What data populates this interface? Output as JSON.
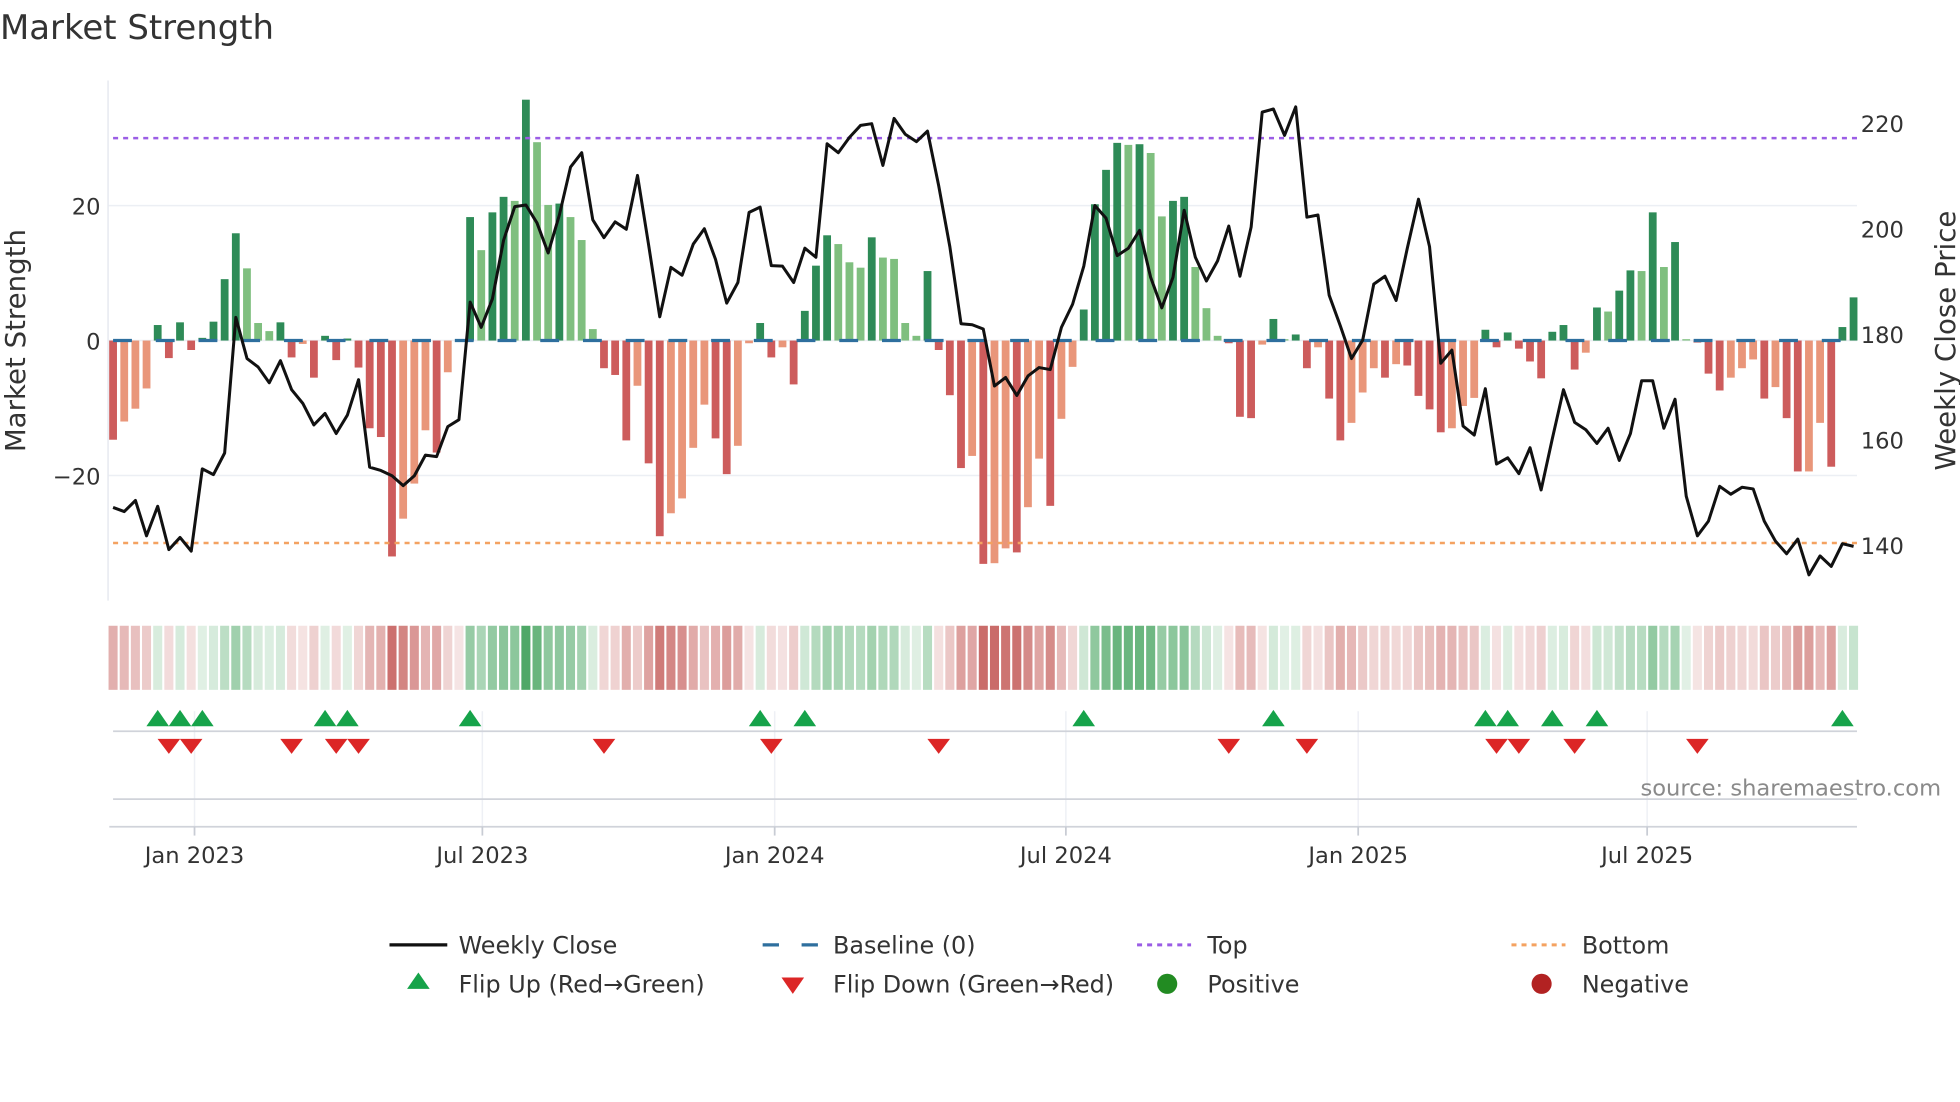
{
  "title": "Market Strength",
  "source": "source: sharemaestro.com",
  "colors": {
    "pos_dark": "#2e8b57",
    "pos_light": "#7fbf7f",
    "neg_dark": "#cd5c5c",
    "neg_light": "#e9967a",
    "heat_pos": "#3a9e55",
    "heat_neg": "#c0504d",
    "close": "#111111",
    "baseline": "#2e6f9e",
    "top": "#9b5de5",
    "bottom": "#f4a261",
    "flip_up": "#16a34a",
    "flip_down": "#dc2626",
    "positive": "#228b22",
    "negative": "#b22222"
  },
  "chart_data": {
    "type": "bar",
    "title": "Market Strength",
    "frequency": "weekly",
    "ylabel": "Market Strength",
    "y2label": "Weekly Close Price",
    "ylim": [
      -36,
      41
    ],
    "y2lim": [
      129,
      223
    ],
    "yticks": [
      {
        "value": 20,
        "label": "20"
      },
      {
        "value": 0,
        "label": "0"
      },
      {
        "value": -20,
        "label": "−20"
      }
    ],
    "y2ticks": [
      {
        "value": 220,
        "label": "220"
      },
      {
        "value": 200,
        "label": "200"
      },
      {
        "value": 180,
        "label": "180"
      },
      {
        "value": 160,
        "label": "160"
      },
      {
        "value": 140,
        "label": "140"
      }
    ],
    "xticks": [
      {
        "week_index": 7.3,
        "label": "Jan 2023"
      },
      {
        "week_index": 33.1,
        "label": "Jul 2023"
      },
      {
        "week_index": 59.3,
        "label": "Jan 2024"
      },
      {
        "week_index": 85.4,
        "label": "Jul 2024"
      },
      {
        "week_index": 111.6,
        "label": "Jan 2025"
      },
      {
        "week_index": 137.5,
        "label": "Jul 2025"
      }
    ],
    "baseline": 0,
    "top": 30,
    "bottom": -30,
    "strength": [
      -14.7,
      -12,
      -10.1,
      -7.1,
      2.3,
      -2.6,
      2.7,
      -1.4,
      0.4,
      2.8,
      9.1,
      15.9,
      10.7,
      2.6,
      1.4,
      2.7,
      -2.5,
      -0.5,
      -5.5,
      0.7,
      -2.9,
      0.3,
      -4,
      -13,
      -14.3,
      -32,
      -26.4,
      -21.2,
      -13.3,
      -16.6,
      -4.7,
      -0.2,
      18.3,
      13.4,
      19,
      21.3,
      20.7,
      35.7,
      29.4,
      20.1,
      20.3,
      18.3,
      14.9,
      1.7,
      -4.1,
      -5.1,
      -14.8,
      -6.7,
      -18.2,
      -29,
      -25.6,
      -23.4,
      -15.9,
      -9.5,
      -14.5,
      -19.8,
      -15.6,
      -0.4,
      2.6,
      -2.5,
      -1,
      -6.5,
      4.4,
      11.1,
      15.6,
      14.3,
      11.6,
      10.8,
      15.3,
      12.3,
      12.1,
      2.6,
      0.7,
      10.3,
      -1.4,
      -8.1,
      -18.9,
      -17.1,
      -33.1,
      -33,
      -30.8,
      -31.4,
      -24.7,
      -17.5,
      -24.5,
      -11.6,
      -3.9,
      4.6,
      20.2,
      25.3,
      29.3,
      29,
      29.1,
      27.8,
      18.4,
      20.7,
      21.3,
      10.9,
      4.8,
      0.7,
      -0.4,
      -11.3,
      -11.5,
      -0.6,
      3.2,
      0.2,
      0.9,
      -4.1,
      -1,
      -8.6,
      -14.8,
      -12.2,
      -7.7,
      -4.1,
      -5.5,
      -3.5,
      -3.7,
      -8.2,
      -10.2,
      -13.6,
      -13,
      -9.7,
      -8.5,
      1.6,
      -1,
      1.2,
      -1.2,
      -3.1,
      -5.6,
      1.3,
      2.3,
      -4.3,
      -1.8,
      4.9,
      4.3,
      7.4,
      10.4,
      10.3,
      19,
      10.9,
      14.6,
      0.2,
      -0.3,
      -4.9,
      -7.4,
      -5.5,
      -4.1,
      -2.8,
      -8.6,
      -6.9,
      -11.5,
      -19.4,
      -19.4,
      -12.2,
      -18.7,
      2,
      6.4
    ],
    "close": [
      147.2,
      146.4,
      148.5,
      141.8,
      147.4,
      139.2,
      141.5,
      138.9,
      154.5,
      153.4,
      157.5,
      183.2,
      175.4,
      173.8,
      170.8,
      175,
      169.5,
      166.9,
      162.8,
      165,
      161.2,
      164.7,
      171.4,
      154.8,
      154.2,
      153.2,
      151.3,
      153.2,
      157.1,
      156.8,
      162.5,
      163.8,
      186.1,
      181.3,
      186.7,
      197.8,
      204.2,
      204.5,
      201.1,
      195.4,
      202.6,
      211.7,
      214.4,
      201.7,
      198.3,
      201.3,
      199.9,
      210.1,
      197,
      183.3,
      192.7,
      191.2,
      197.1,
      200,
      194.2,
      185.9,
      189.8,
      203.1,
      204.1,
      193,
      192.9,
      189.8,
      196.3,
      194.6,
      216.1,
      214.4,
      217.3,
      219.6,
      219.9,
      212,
      220.9,
      217.9,
      216.5,
      218.5,
      208.2,
      196.6,
      182,
      181.8,
      181,
      170.2,
      171.8,
      168.4,
      172.1,
      173.7,
      173.3,
      181.3,
      185.7,
      192.9,
      204.4,
      202,
      194.9,
      196.3,
      199.7,
      190.8,
      185,
      190.8,
      203.5,
      194.6,
      190.1,
      193.9,
      200.5,
      191,
      200.3,
      222.1,
      222.7,
      217.7,
      223.1,
      202.2,
      202.6,
      187.4,
      181.6,
      175.4,
      178.9,
      189.5,
      191,
      186.4,
      196.3,
      205.6,
      196.6,
      174.5,
      177,
      162.6,
      160.9,
      169.7,
      155.4,
      156.6,
      153.6,
      158.5,
      150.5,
      160.2,
      169.5,
      163.3,
      161.9,
      159.3,
      162.2,
      156.1,
      161.2,
      171.2,
      171.2,
      162.2,
      167.7,
      149.3,
      141.8,
      144.6,
      151.2,
      149.7,
      151,
      150.7,
      144.6,
      140.8,
      138.4,
      141.2,
      134.4,
      138,
      136,
      140.3,
      139.8
    ],
    "legend": {
      "placement": "bottom",
      "items": [
        {
          "key": "close",
          "label": "Weekly Close"
        },
        {
          "key": "baseline",
          "label": "Baseline (0)"
        },
        {
          "key": "top",
          "label": "Top"
        },
        {
          "key": "bottom",
          "label": "Bottom"
        },
        {
          "key": "flip_up",
          "label": "Flip Up (Red→Green)"
        },
        {
          "key": "flip_down",
          "label": "Flip Down (Green→Red)"
        },
        {
          "key": "positive",
          "label": "Positive"
        },
        {
          "key": "negative",
          "label": "Negative"
        }
      ]
    }
  }
}
